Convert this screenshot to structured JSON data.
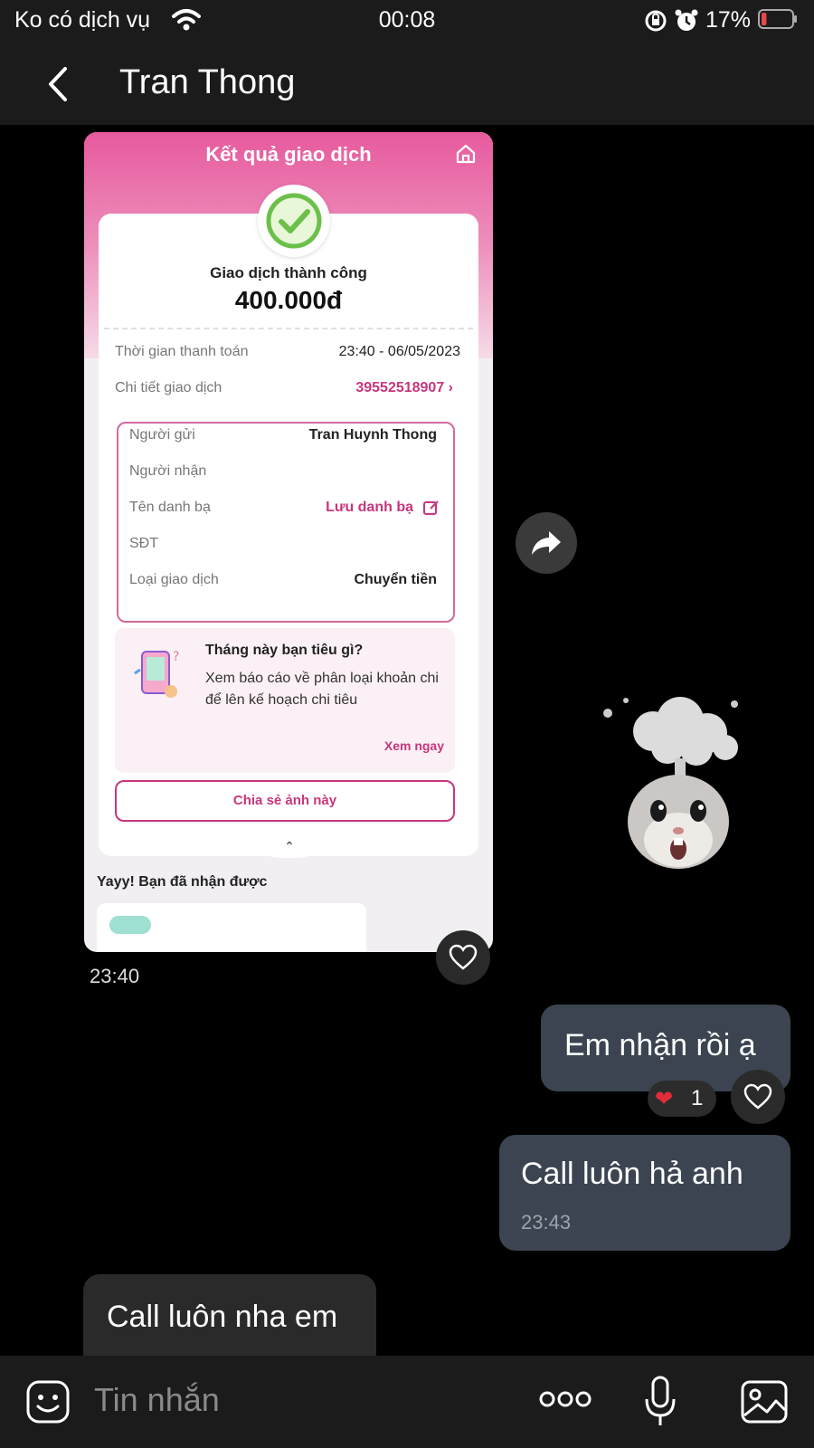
{
  "status_bar": {
    "carrier": "Ko có dịch vụ",
    "time": "00:08",
    "battery_percent": "17%",
    "battery_level": 0.17,
    "battery_color": "#e5484d",
    "icons": [
      "wifi-icon",
      "rotation-lock-icon",
      "alarm-icon",
      "battery-icon"
    ]
  },
  "header": {
    "title": "Tran Thong",
    "back_icon": "chevron-left-icon"
  },
  "receipt": {
    "title": "Kết quả giao dịch",
    "status": "Giao dịch thành công",
    "amount": "400.000đ",
    "payment_time_label": "Thời gian thanh toán",
    "payment_time_value": "23:40 - 06/05/2023",
    "detail_label": "Chi tiết giao dịch",
    "detail_value": "39552518907 ›",
    "sender_label": "Người gửi",
    "sender_value": "Tran Huynh Thong",
    "receiver_label": "Người nhận",
    "contact_label": "Tên danh bạ",
    "contact_value": "Lưu danh bạ",
    "phone_label": "SĐT",
    "type_label": "Loại giao dịch",
    "type_value": "Chuyển tiền",
    "promo_title": "Tháng này bạn tiêu gì?",
    "promo_text": "Xem báo cáo về phân loại khoản chi để lên kế hoạch chi tiêu",
    "promo_link": "Xem ngay",
    "share_button": "Chia sẻ ảnh này",
    "caret": "⌃",
    "received_text": "Yayy! Bạn đã nhận được",
    "accent_color": "#c8367c"
  },
  "messages": {
    "image_time": "23:40",
    "msg1": "Em nhận rồi ạ",
    "msg1_reaction_icon": "heart-icon",
    "msg1_reaction_count": "1",
    "msg2": "Call luôn hả anh",
    "msg2_time": "23:43",
    "msg3": "Call luôn nha em"
  },
  "input_bar": {
    "placeholder": "Tin nhắn",
    "icons": [
      "emoji-icon",
      "more-icon",
      "microphone-icon",
      "image-icon"
    ]
  }
}
